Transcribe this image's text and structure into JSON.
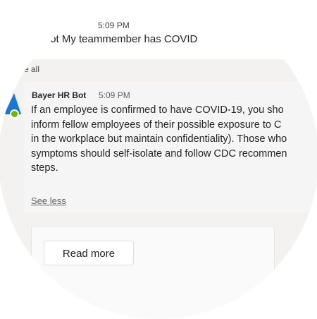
{
  "thread_reply": {
    "time": "5:09 PM",
    "text": "ɔt My teammember has COVID"
  },
  "see_all_label": "e all",
  "message": {
    "sender": "Bayer HR Bot",
    "time": "5:09 PM",
    "lines": [
      "If an employee is confirmed to have COVID-19, you sho",
      "inform fellow employees of their possible exposure to C",
      "in the workplace but maintain confidentiality). Those who",
      "symptoms should self-isolate and follow CDC recommen",
      "steps."
    ],
    "see_less_label": "See less"
  },
  "card": {
    "button_label": "Read more"
  },
  "colors": {
    "bot_icon": "#1878d3",
    "presence": "#6bb700",
    "bubble": "#f5f5f5"
  },
  "icons": {
    "avatar": "bot-avatar-icon",
    "status": "presence-available-icon"
  }
}
